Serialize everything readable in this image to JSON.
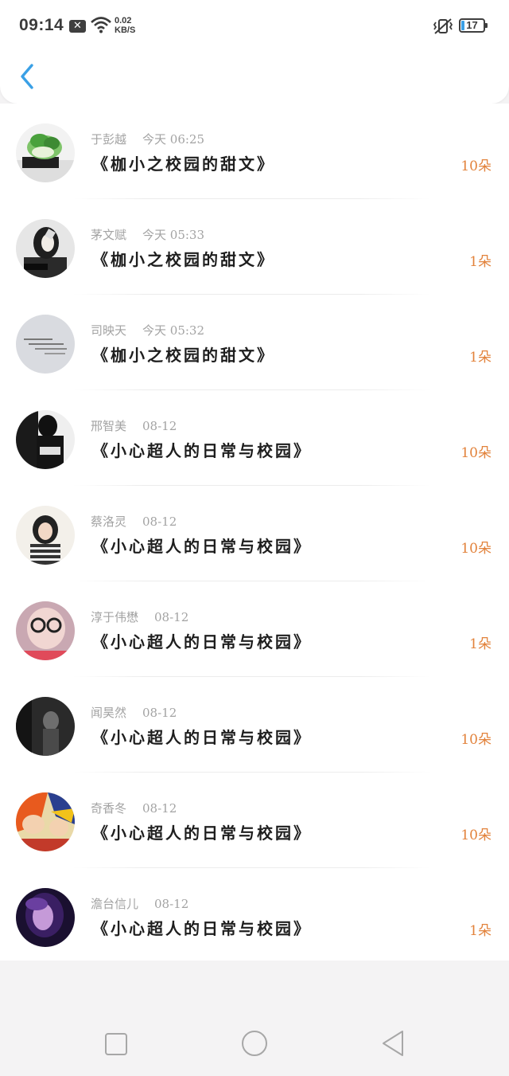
{
  "status_bar": {
    "time": "09:14",
    "net_speed_value": "0.02",
    "net_speed_unit": "KB/S",
    "battery": "17",
    "icons": [
      "notification-x-icon",
      "wifi-icon",
      "vibrate-icon",
      "battery-icon"
    ]
  },
  "header": {
    "back_icon": "chevron-left-icon",
    "accent": "#3aa0e6"
  },
  "colors": {
    "count": "#e2823b",
    "title": "#1e1e1e",
    "meta": "#a3a3a3"
  },
  "rows": [
    {
      "name": "于彭越",
      "date": "今天 06:25",
      "title": "《枷小之校园的甜文》",
      "count": "10朵",
      "avatar": "cabbage"
    },
    {
      "name": "茅文赋",
      "date": "今天 05:33",
      "title": "《枷小之校园的甜文》",
      "count": "1朵",
      "avatar": "girl-mask"
    },
    {
      "name": "司映天",
      "date": "今天 05:32",
      "title": "《枷小之校园的甜文》",
      "count": "1朵",
      "avatar": "text-card"
    },
    {
      "name": "邢智美",
      "date": "08-12",
      "title": "《小心超人的日常与校园》",
      "count": "10朵",
      "avatar": "bw-girl"
    },
    {
      "name": "蔡洛灵",
      "date": "08-12",
      "title": "《小心超人的日常与校园》",
      "count": "10朵",
      "avatar": "hood-girl"
    },
    {
      "name": "淳于伟懋",
      "date": "08-12",
      "title": "《小心超人的日常与校园》",
      "count": "1朵",
      "avatar": "glasses-girl"
    },
    {
      "name": "闻昊然",
      "date": "08-12",
      "title": "《小心超人的日常与校园》",
      "count": "10朵",
      "avatar": "dark-girl"
    },
    {
      "name": "奇香冬",
      "date": "08-12",
      "title": "《小心超人的日常与校园》",
      "count": "10朵",
      "avatar": "anime"
    },
    {
      "name": "澹台信儿",
      "date": "08-12",
      "title": "《小心超人的日常与校园》",
      "count": "1朵",
      "avatar": "purple-girl"
    }
  ],
  "nav_bar": {
    "icons": [
      "recent-apps-icon",
      "home-icon",
      "back-icon"
    ]
  }
}
